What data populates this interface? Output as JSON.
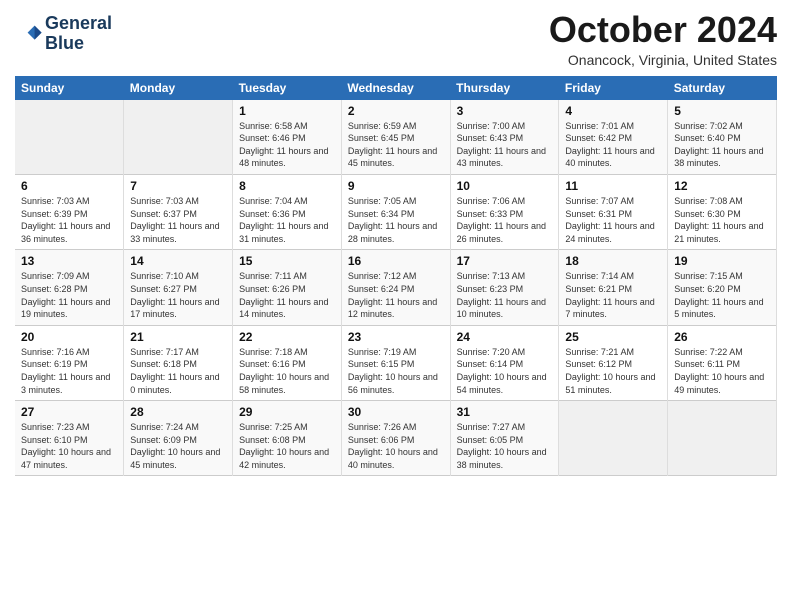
{
  "header": {
    "logo_line1": "General",
    "logo_line2": "Blue",
    "month_title": "October 2024",
    "location": "Onancock, Virginia, United States"
  },
  "days_of_week": [
    "Sunday",
    "Monday",
    "Tuesday",
    "Wednesday",
    "Thursday",
    "Friday",
    "Saturday"
  ],
  "weeks": [
    [
      {
        "day": "",
        "empty": true
      },
      {
        "day": "",
        "empty": true
      },
      {
        "day": "1",
        "sunrise": "Sunrise: 6:58 AM",
        "sunset": "Sunset: 6:46 PM",
        "daylight": "Daylight: 11 hours and 48 minutes."
      },
      {
        "day": "2",
        "sunrise": "Sunrise: 6:59 AM",
        "sunset": "Sunset: 6:45 PM",
        "daylight": "Daylight: 11 hours and 45 minutes."
      },
      {
        "day": "3",
        "sunrise": "Sunrise: 7:00 AM",
        "sunset": "Sunset: 6:43 PM",
        "daylight": "Daylight: 11 hours and 43 minutes."
      },
      {
        "day": "4",
        "sunrise": "Sunrise: 7:01 AM",
        "sunset": "Sunset: 6:42 PM",
        "daylight": "Daylight: 11 hours and 40 minutes."
      },
      {
        "day": "5",
        "sunrise": "Sunrise: 7:02 AM",
        "sunset": "Sunset: 6:40 PM",
        "daylight": "Daylight: 11 hours and 38 minutes."
      }
    ],
    [
      {
        "day": "6",
        "sunrise": "Sunrise: 7:03 AM",
        "sunset": "Sunset: 6:39 PM",
        "daylight": "Daylight: 11 hours and 36 minutes."
      },
      {
        "day": "7",
        "sunrise": "Sunrise: 7:03 AM",
        "sunset": "Sunset: 6:37 PM",
        "daylight": "Daylight: 11 hours and 33 minutes."
      },
      {
        "day": "8",
        "sunrise": "Sunrise: 7:04 AM",
        "sunset": "Sunset: 6:36 PM",
        "daylight": "Daylight: 11 hours and 31 minutes."
      },
      {
        "day": "9",
        "sunrise": "Sunrise: 7:05 AM",
        "sunset": "Sunset: 6:34 PM",
        "daylight": "Daylight: 11 hours and 28 minutes."
      },
      {
        "day": "10",
        "sunrise": "Sunrise: 7:06 AM",
        "sunset": "Sunset: 6:33 PM",
        "daylight": "Daylight: 11 hours and 26 minutes."
      },
      {
        "day": "11",
        "sunrise": "Sunrise: 7:07 AM",
        "sunset": "Sunset: 6:31 PM",
        "daylight": "Daylight: 11 hours and 24 minutes."
      },
      {
        "day": "12",
        "sunrise": "Sunrise: 7:08 AM",
        "sunset": "Sunset: 6:30 PM",
        "daylight": "Daylight: 11 hours and 21 minutes."
      }
    ],
    [
      {
        "day": "13",
        "sunrise": "Sunrise: 7:09 AM",
        "sunset": "Sunset: 6:28 PM",
        "daylight": "Daylight: 11 hours and 19 minutes."
      },
      {
        "day": "14",
        "sunrise": "Sunrise: 7:10 AM",
        "sunset": "Sunset: 6:27 PM",
        "daylight": "Daylight: 11 hours and 17 minutes."
      },
      {
        "day": "15",
        "sunrise": "Sunrise: 7:11 AM",
        "sunset": "Sunset: 6:26 PM",
        "daylight": "Daylight: 11 hours and 14 minutes."
      },
      {
        "day": "16",
        "sunrise": "Sunrise: 7:12 AM",
        "sunset": "Sunset: 6:24 PM",
        "daylight": "Daylight: 11 hours and 12 minutes."
      },
      {
        "day": "17",
        "sunrise": "Sunrise: 7:13 AM",
        "sunset": "Sunset: 6:23 PM",
        "daylight": "Daylight: 11 hours and 10 minutes."
      },
      {
        "day": "18",
        "sunrise": "Sunrise: 7:14 AM",
        "sunset": "Sunset: 6:21 PM",
        "daylight": "Daylight: 11 hours and 7 minutes."
      },
      {
        "day": "19",
        "sunrise": "Sunrise: 7:15 AM",
        "sunset": "Sunset: 6:20 PM",
        "daylight": "Daylight: 11 hours and 5 minutes."
      }
    ],
    [
      {
        "day": "20",
        "sunrise": "Sunrise: 7:16 AM",
        "sunset": "Sunset: 6:19 PM",
        "daylight": "Daylight: 11 hours and 3 minutes."
      },
      {
        "day": "21",
        "sunrise": "Sunrise: 7:17 AM",
        "sunset": "Sunset: 6:18 PM",
        "daylight": "Daylight: 11 hours and 0 minutes."
      },
      {
        "day": "22",
        "sunrise": "Sunrise: 7:18 AM",
        "sunset": "Sunset: 6:16 PM",
        "daylight": "Daylight: 10 hours and 58 minutes."
      },
      {
        "day": "23",
        "sunrise": "Sunrise: 7:19 AM",
        "sunset": "Sunset: 6:15 PM",
        "daylight": "Daylight: 10 hours and 56 minutes."
      },
      {
        "day": "24",
        "sunrise": "Sunrise: 7:20 AM",
        "sunset": "Sunset: 6:14 PM",
        "daylight": "Daylight: 10 hours and 54 minutes."
      },
      {
        "day": "25",
        "sunrise": "Sunrise: 7:21 AM",
        "sunset": "Sunset: 6:12 PM",
        "daylight": "Daylight: 10 hours and 51 minutes."
      },
      {
        "day": "26",
        "sunrise": "Sunrise: 7:22 AM",
        "sunset": "Sunset: 6:11 PM",
        "daylight": "Daylight: 10 hours and 49 minutes."
      }
    ],
    [
      {
        "day": "27",
        "sunrise": "Sunrise: 7:23 AM",
        "sunset": "Sunset: 6:10 PM",
        "daylight": "Daylight: 10 hours and 47 minutes."
      },
      {
        "day": "28",
        "sunrise": "Sunrise: 7:24 AM",
        "sunset": "Sunset: 6:09 PM",
        "daylight": "Daylight: 10 hours and 45 minutes."
      },
      {
        "day": "29",
        "sunrise": "Sunrise: 7:25 AM",
        "sunset": "Sunset: 6:08 PM",
        "daylight": "Daylight: 10 hours and 42 minutes."
      },
      {
        "day": "30",
        "sunrise": "Sunrise: 7:26 AM",
        "sunset": "Sunset: 6:06 PM",
        "daylight": "Daylight: 10 hours and 40 minutes."
      },
      {
        "day": "31",
        "sunrise": "Sunrise: 7:27 AM",
        "sunset": "Sunset: 6:05 PM",
        "daylight": "Daylight: 10 hours and 38 minutes."
      },
      {
        "day": "",
        "empty": true
      },
      {
        "day": "",
        "empty": true
      }
    ]
  ]
}
